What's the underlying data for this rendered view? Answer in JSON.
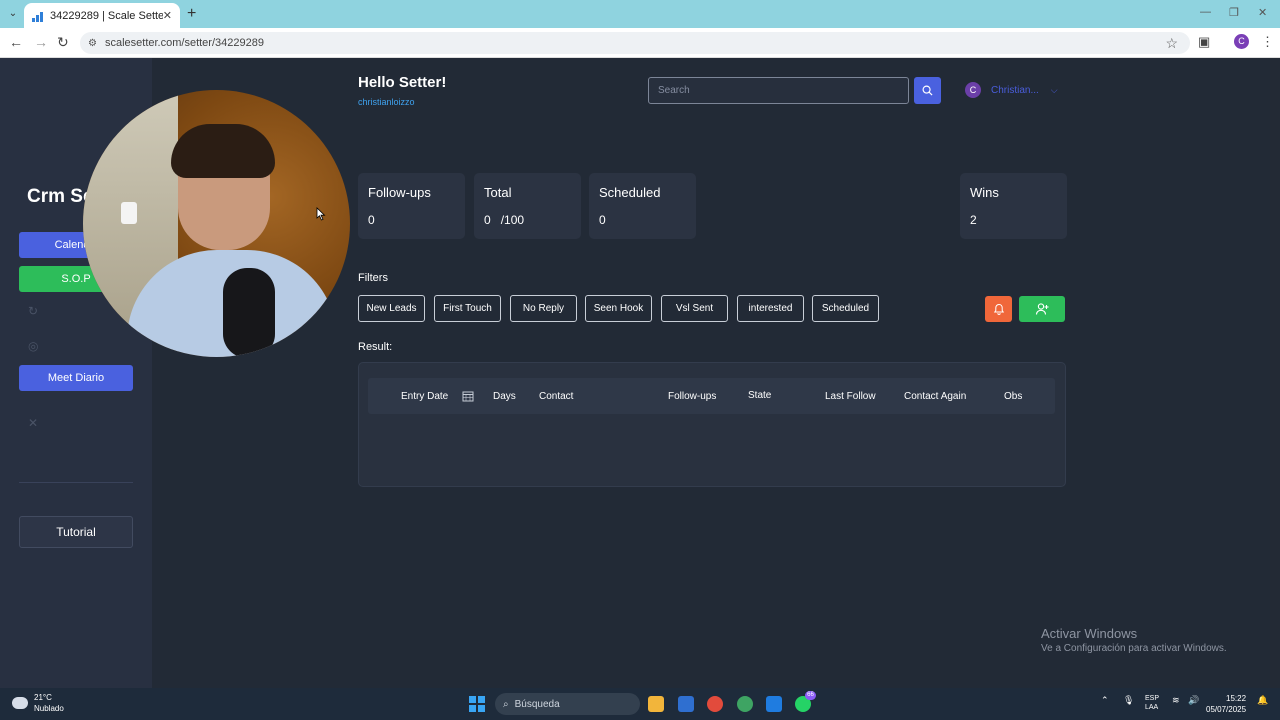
{
  "browser": {
    "tab_title": "34229289 | Scale Setter",
    "url": "scalesetter.com/setter/34229289",
    "profile_initial": "C"
  },
  "sidebar": {
    "brand": "Crm Se",
    "calendly_label": "Calendly",
    "sop_label": "S.O.P",
    "meet_label": "Meet Diario",
    "tutorial_label": "Tutorial"
  },
  "header": {
    "greeting": "Hello Setter!",
    "username": "christianloizzo",
    "search_placeholder": "Search",
    "user_initial": "C",
    "user_name": "Christian..."
  },
  "stats": [
    {
      "title": "Follow-ups",
      "value": "0"
    },
    {
      "title": "Total",
      "value": "0",
      "suffix": "/100"
    },
    {
      "title": "Scheduled",
      "value": "0"
    },
    {
      "title": "Wins",
      "value": "2"
    }
  ],
  "filters": {
    "label": "Filters",
    "buttons": [
      "New Leads",
      "First Touch",
      "No Reply",
      "Seen Hook",
      "Vsl Sent",
      "interested",
      "Scheduled"
    ]
  },
  "results": {
    "label": "Result:",
    "columns": [
      "Entry Date",
      "Days",
      "Contact",
      "Follow-ups",
      "State",
      "Last Follow",
      "Contact Again",
      "Obs"
    ]
  },
  "watermark": {
    "line1": "Activar Windows",
    "line2": "Ve a Configuración para activar Windows."
  },
  "taskbar": {
    "temperature": "21°C",
    "weather": "Nublado",
    "search": "Búsqueda",
    "lang1": "ESP",
    "lang2": "LAA",
    "time": "15:22",
    "date": "05/07/2025",
    "badge": "66"
  },
  "colors": {
    "accent_blue": "#4a61df",
    "green": "#2dbd5a",
    "orange": "#f0673a",
    "background": "#222a36"
  }
}
